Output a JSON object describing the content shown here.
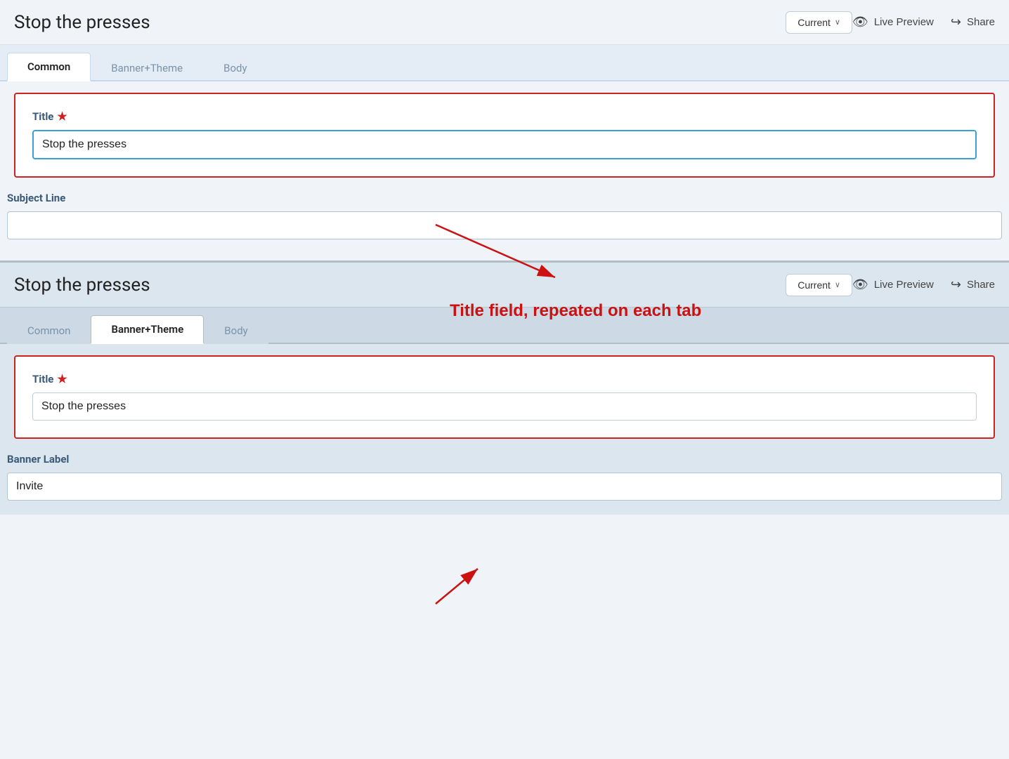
{
  "page_title": "Stop the presses",
  "section1": {
    "header": {
      "title": "Stop the presses",
      "dropdown_label": "Current",
      "live_preview_label": "Live Preview",
      "share_label": "Share"
    },
    "tabs": [
      {
        "label": "Common",
        "active": true
      },
      {
        "label": "Banner+Theme",
        "active": false
      },
      {
        "label": "Body",
        "active": false
      }
    ],
    "title_field": {
      "label": "Title",
      "required": true,
      "value": "Stop the presses",
      "placeholder": ""
    },
    "subject_field": {
      "label": "Subject Line",
      "value": "",
      "placeholder": ""
    }
  },
  "section2": {
    "header": {
      "title": "Stop the presses",
      "dropdown_label": "Current",
      "live_preview_label": "Live Preview",
      "share_label": "Share"
    },
    "tabs": [
      {
        "label": "Common",
        "active": false
      },
      {
        "label": "Banner+Theme",
        "active": true
      },
      {
        "label": "Body",
        "active": false
      }
    ],
    "title_field": {
      "label": "Title",
      "required": true,
      "value": "Stop the presses"
    },
    "banner_field": {
      "label": "Banner Label",
      "value": "Invite"
    }
  },
  "annotation": {
    "text": "Title field, repeated on each tab"
  },
  "icons": {
    "eye": "👁",
    "share": "↪",
    "chevron_down": "∨"
  }
}
